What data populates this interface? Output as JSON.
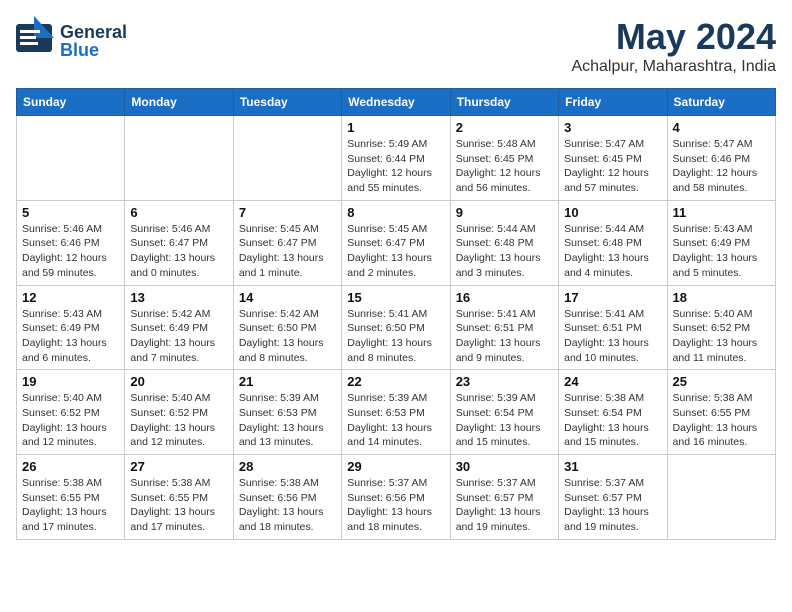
{
  "header": {
    "logo_general": "General",
    "logo_blue": "Blue",
    "title": "May 2024",
    "location": "Achalpur, Maharashtra, India"
  },
  "calendar": {
    "days_of_week": [
      "Sunday",
      "Monday",
      "Tuesday",
      "Wednesday",
      "Thursday",
      "Friday",
      "Saturday"
    ],
    "weeks": [
      [
        {
          "day": "",
          "info": ""
        },
        {
          "day": "",
          "info": ""
        },
        {
          "day": "",
          "info": ""
        },
        {
          "day": "1",
          "info": "Sunrise: 5:49 AM\nSunset: 6:44 PM\nDaylight: 12 hours\nand 55 minutes."
        },
        {
          "day": "2",
          "info": "Sunrise: 5:48 AM\nSunset: 6:45 PM\nDaylight: 12 hours\nand 56 minutes."
        },
        {
          "day": "3",
          "info": "Sunrise: 5:47 AM\nSunset: 6:45 PM\nDaylight: 12 hours\nand 57 minutes."
        },
        {
          "day": "4",
          "info": "Sunrise: 5:47 AM\nSunset: 6:46 PM\nDaylight: 12 hours\nand 58 minutes."
        }
      ],
      [
        {
          "day": "5",
          "info": "Sunrise: 5:46 AM\nSunset: 6:46 PM\nDaylight: 12 hours\nand 59 minutes."
        },
        {
          "day": "6",
          "info": "Sunrise: 5:46 AM\nSunset: 6:47 PM\nDaylight: 13 hours\nand 0 minutes."
        },
        {
          "day": "7",
          "info": "Sunrise: 5:45 AM\nSunset: 6:47 PM\nDaylight: 13 hours\nand 1 minute."
        },
        {
          "day": "8",
          "info": "Sunrise: 5:45 AM\nSunset: 6:47 PM\nDaylight: 13 hours\nand 2 minutes."
        },
        {
          "day": "9",
          "info": "Sunrise: 5:44 AM\nSunset: 6:48 PM\nDaylight: 13 hours\nand 3 minutes."
        },
        {
          "day": "10",
          "info": "Sunrise: 5:44 AM\nSunset: 6:48 PM\nDaylight: 13 hours\nand 4 minutes."
        },
        {
          "day": "11",
          "info": "Sunrise: 5:43 AM\nSunset: 6:49 PM\nDaylight: 13 hours\nand 5 minutes."
        }
      ],
      [
        {
          "day": "12",
          "info": "Sunrise: 5:43 AM\nSunset: 6:49 PM\nDaylight: 13 hours\nand 6 minutes."
        },
        {
          "day": "13",
          "info": "Sunrise: 5:42 AM\nSunset: 6:49 PM\nDaylight: 13 hours\nand 7 minutes."
        },
        {
          "day": "14",
          "info": "Sunrise: 5:42 AM\nSunset: 6:50 PM\nDaylight: 13 hours\nand 8 minutes."
        },
        {
          "day": "15",
          "info": "Sunrise: 5:41 AM\nSunset: 6:50 PM\nDaylight: 13 hours\nand 8 minutes."
        },
        {
          "day": "16",
          "info": "Sunrise: 5:41 AM\nSunset: 6:51 PM\nDaylight: 13 hours\nand 9 minutes."
        },
        {
          "day": "17",
          "info": "Sunrise: 5:41 AM\nSunset: 6:51 PM\nDaylight: 13 hours\nand 10 minutes."
        },
        {
          "day": "18",
          "info": "Sunrise: 5:40 AM\nSunset: 6:52 PM\nDaylight: 13 hours\nand 11 minutes."
        }
      ],
      [
        {
          "day": "19",
          "info": "Sunrise: 5:40 AM\nSunset: 6:52 PM\nDaylight: 13 hours\nand 12 minutes."
        },
        {
          "day": "20",
          "info": "Sunrise: 5:40 AM\nSunset: 6:52 PM\nDaylight: 13 hours\nand 12 minutes."
        },
        {
          "day": "21",
          "info": "Sunrise: 5:39 AM\nSunset: 6:53 PM\nDaylight: 13 hours\nand 13 minutes."
        },
        {
          "day": "22",
          "info": "Sunrise: 5:39 AM\nSunset: 6:53 PM\nDaylight: 13 hours\nand 14 minutes."
        },
        {
          "day": "23",
          "info": "Sunrise: 5:39 AM\nSunset: 6:54 PM\nDaylight: 13 hours\nand 15 minutes."
        },
        {
          "day": "24",
          "info": "Sunrise: 5:38 AM\nSunset: 6:54 PM\nDaylight: 13 hours\nand 15 minutes."
        },
        {
          "day": "25",
          "info": "Sunrise: 5:38 AM\nSunset: 6:55 PM\nDaylight: 13 hours\nand 16 minutes."
        }
      ],
      [
        {
          "day": "26",
          "info": "Sunrise: 5:38 AM\nSunset: 6:55 PM\nDaylight: 13 hours\nand 17 minutes."
        },
        {
          "day": "27",
          "info": "Sunrise: 5:38 AM\nSunset: 6:55 PM\nDaylight: 13 hours\nand 17 minutes."
        },
        {
          "day": "28",
          "info": "Sunrise: 5:38 AM\nSunset: 6:56 PM\nDaylight: 13 hours\nand 18 minutes."
        },
        {
          "day": "29",
          "info": "Sunrise: 5:37 AM\nSunset: 6:56 PM\nDaylight: 13 hours\nand 18 minutes."
        },
        {
          "day": "30",
          "info": "Sunrise: 5:37 AM\nSunset: 6:57 PM\nDaylight: 13 hours\nand 19 minutes."
        },
        {
          "day": "31",
          "info": "Sunrise: 5:37 AM\nSunset: 6:57 PM\nDaylight: 13 hours\nand 19 minutes."
        },
        {
          "day": "",
          "info": ""
        }
      ]
    ]
  }
}
